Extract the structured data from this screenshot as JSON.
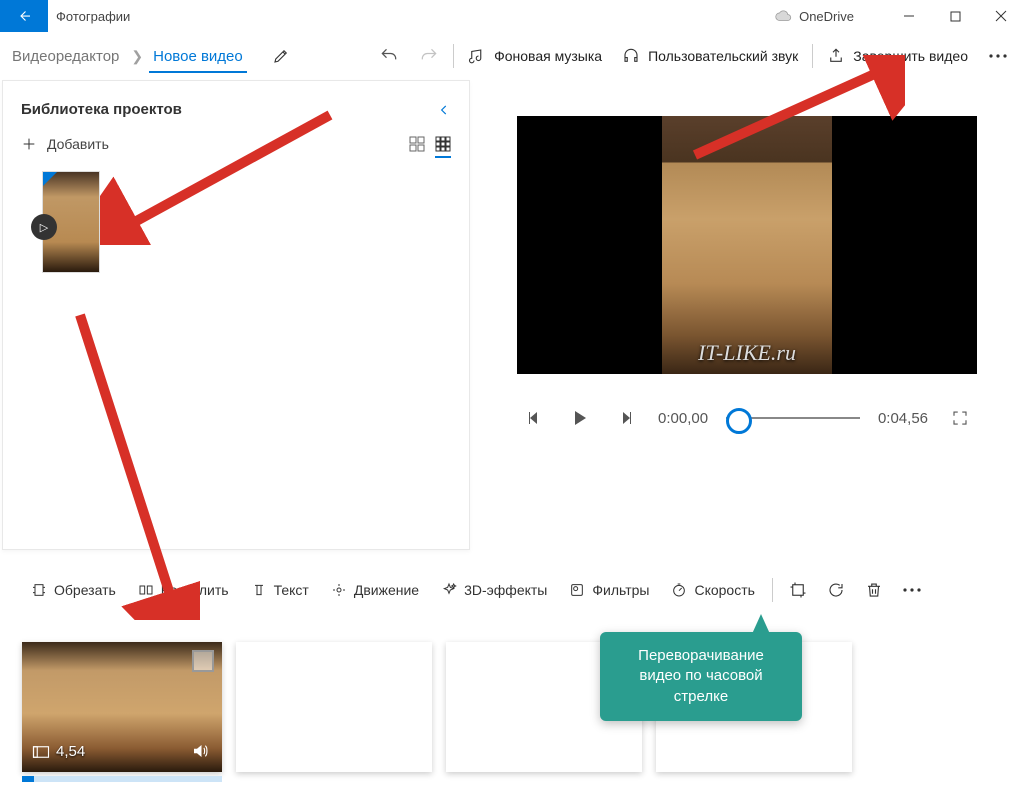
{
  "app_title": "Фотографии",
  "onedrive": "OneDrive",
  "breadcrumb": {
    "root": "Видеоредактор",
    "current": "Новое видео"
  },
  "toolbar": {
    "bg_music": "Фоновая музыка",
    "custom_audio": "Пользовательский звук",
    "finish": "Завершить видео"
  },
  "panel": {
    "title": "Библиотека проектов",
    "add": "Добавить"
  },
  "player": {
    "watermark": "IT-LIKE.ru",
    "time_cur": "0:00,00",
    "time_total": "0:04,56"
  },
  "editbar": {
    "trim": "Обрезать",
    "split": "Разделить",
    "text": "Текст",
    "motion": "Движение",
    "fx3d": "3D-эффекты",
    "filters": "Фильтры",
    "speed": "Скорость"
  },
  "clip": {
    "duration": "4,54"
  },
  "callout": "Переворачивание видео по часовой стрелке"
}
